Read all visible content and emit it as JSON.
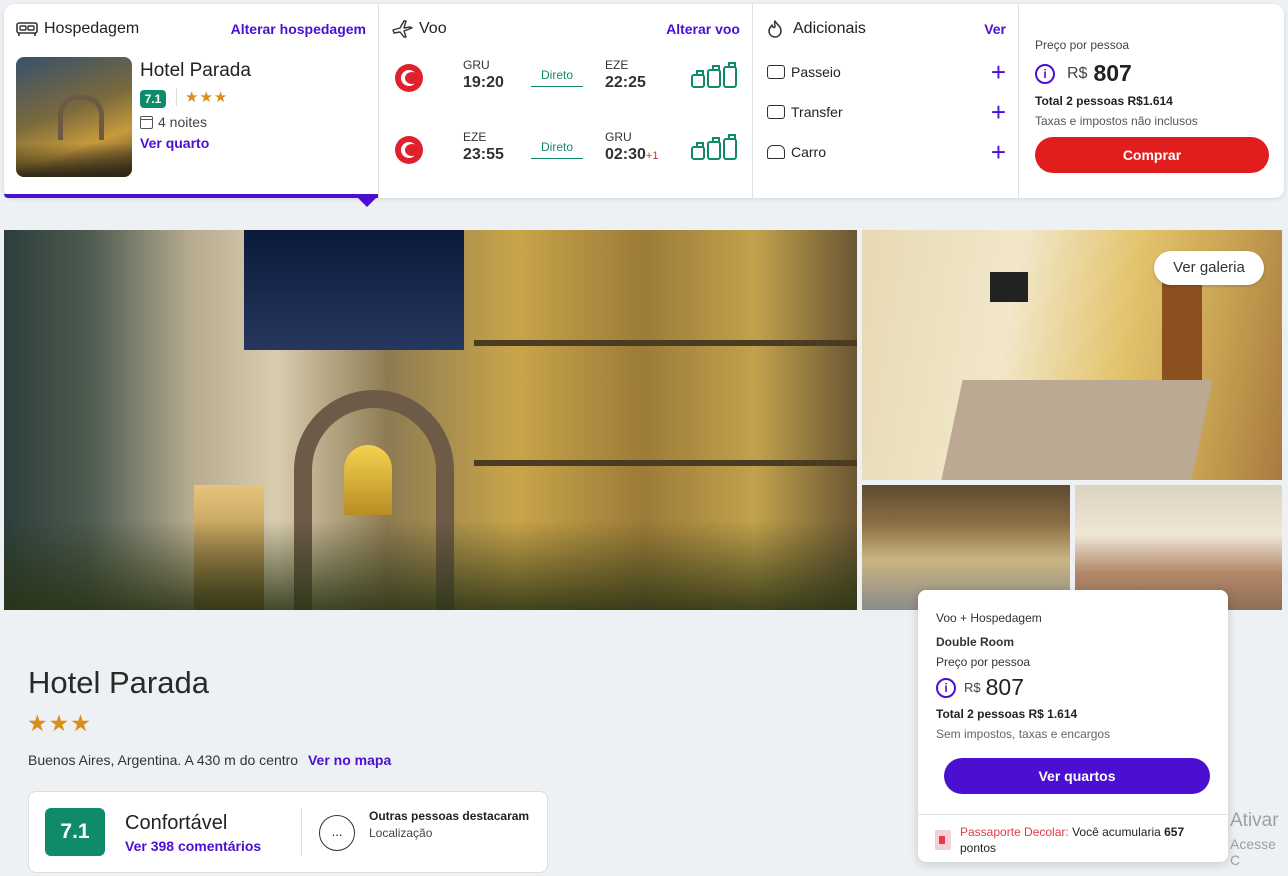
{
  "hotel_section": {
    "title": "Hospedagem",
    "change_link": "Alterar hospedagem",
    "hotel_name": "Hotel Parada",
    "score": "7.1",
    "stars": "★★★",
    "nights": "4 noites",
    "see_room": "Ver quarto"
  },
  "flight_section": {
    "title": "Voo",
    "change_link": "Alterar voo",
    "legs": [
      {
        "from_code": "GRU",
        "from_time": "19:20",
        "stops": "Direto",
        "to_code": "EZE",
        "to_time": "22:25",
        "next_day": ""
      },
      {
        "from_code": "EZE",
        "from_time": "23:55",
        "stops": "Direto",
        "to_code": "GRU",
        "to_time": "02:30",
        "next_day": "+1"
      }
    ]
  },
  "extras_section": {
    "title": "Adicionais",
    "link": "Ver",
    "items": [
      {
        "label": "Passeio",
        "add": "+"
      },
      {
        "label": "Transfer",
        "add": "+"
      },
      {
        "label": "Carro",
        "add": "+"
      }
    ]
  },
  "price_section": {
    "label": "Preço por pessoa",
    "currency": "R$",
    "amount": "807",
    "total": "Total 2 pessoas R$1.614",
    "tax_note": "Taxas e impostos não inclusos",
    "buy_button": "Comprar"
  },
  "gallery": {
    "see_gallery": "Ver galeria"
  },
  "hotel_info": {
    "title": "Hotel Parada",
    "stars": "★★★",
    "location": "Buenos Aires, Argentina. A 430 m do centro",
    "map_link": "Ver no mapa",
    "rating": {
      "score": "7.1",
      "word": "Confortável",
      "count_link": "Ver 398 comentários",
      "chat_icon": "...",
      "highlight_title": "Outras pessoas destacaram",
      "highlight_value": "Localização"
    }
  },
  "float_card": {
    "subtitle": "Voo + Hospedagem",
    "room": "Double Room",
    "price_label": "Preço por pessoa",
    "currency": "R$",
    "amount": "807",
    "total": "Total 2 pessoas R$ 1.614",
    "tax_note": "Sem impostos, taxas e encargos",
    "button": "Ver quartos",
    "passport_brand": "Passaporte Decolar:",
    "passport_text": " Você acumularia ",
    "passport_points": "657",
    "passport_suffix": "pontos"
  },
  "watermark": {
    "line1": "Ativar",
    "line2": "Acesse C"
  },
  "colors": {
    "accent": "#4b0fd1",
    "buy": "#e11d1d",
    "score": "#0f8a6a",
    "stars": "#d98e19"
  }
}
